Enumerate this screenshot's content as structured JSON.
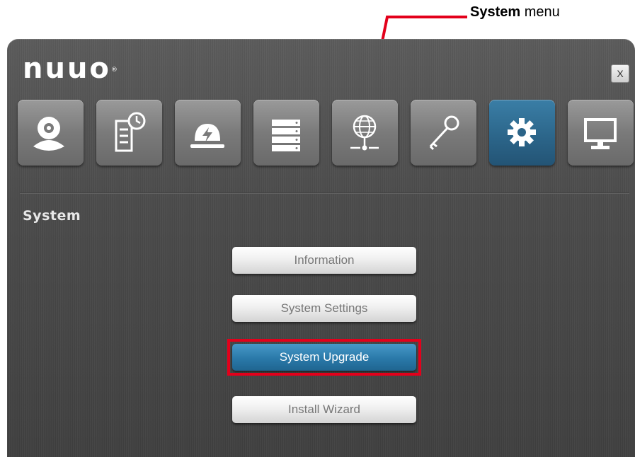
{
  "callout": {
    "bold": "System",
    "rest": " menu"
  },
  "window": {
    "logo": "nuuo",
    "logo_mark": "®",
    "close_label": "X",
    "tiles": [
      {
        "icon": "camera-icon"
      },
      {
        "icon": "schedule-log-icon"
      },
      {
        "icon": "alarm-icon"
      },
      {
        "icon": "storage-icon"
      },
      {
        "icon": "network-icon"
      },
      {
        "icon": "key-icon"
      },
      {
        "icon": "gear-icon",
        "active": true
      },
      {
        "icon": "monitor-icon"
      }
    ],
    "section_title": "System",
    "menu": [
      {
        "label": "Information"
      },
      {
        "label": "System Settings"
      },
      {
        "label": "System Upgrade",
        "active": true
      },
      {
        "label": "Install Wizard"
      }
    ]
  },
  "colors": {
    "accent": "#2a79a9",
    "highlight": "#e3001b",
    "panel": "#4a4a4a"
  }
}
